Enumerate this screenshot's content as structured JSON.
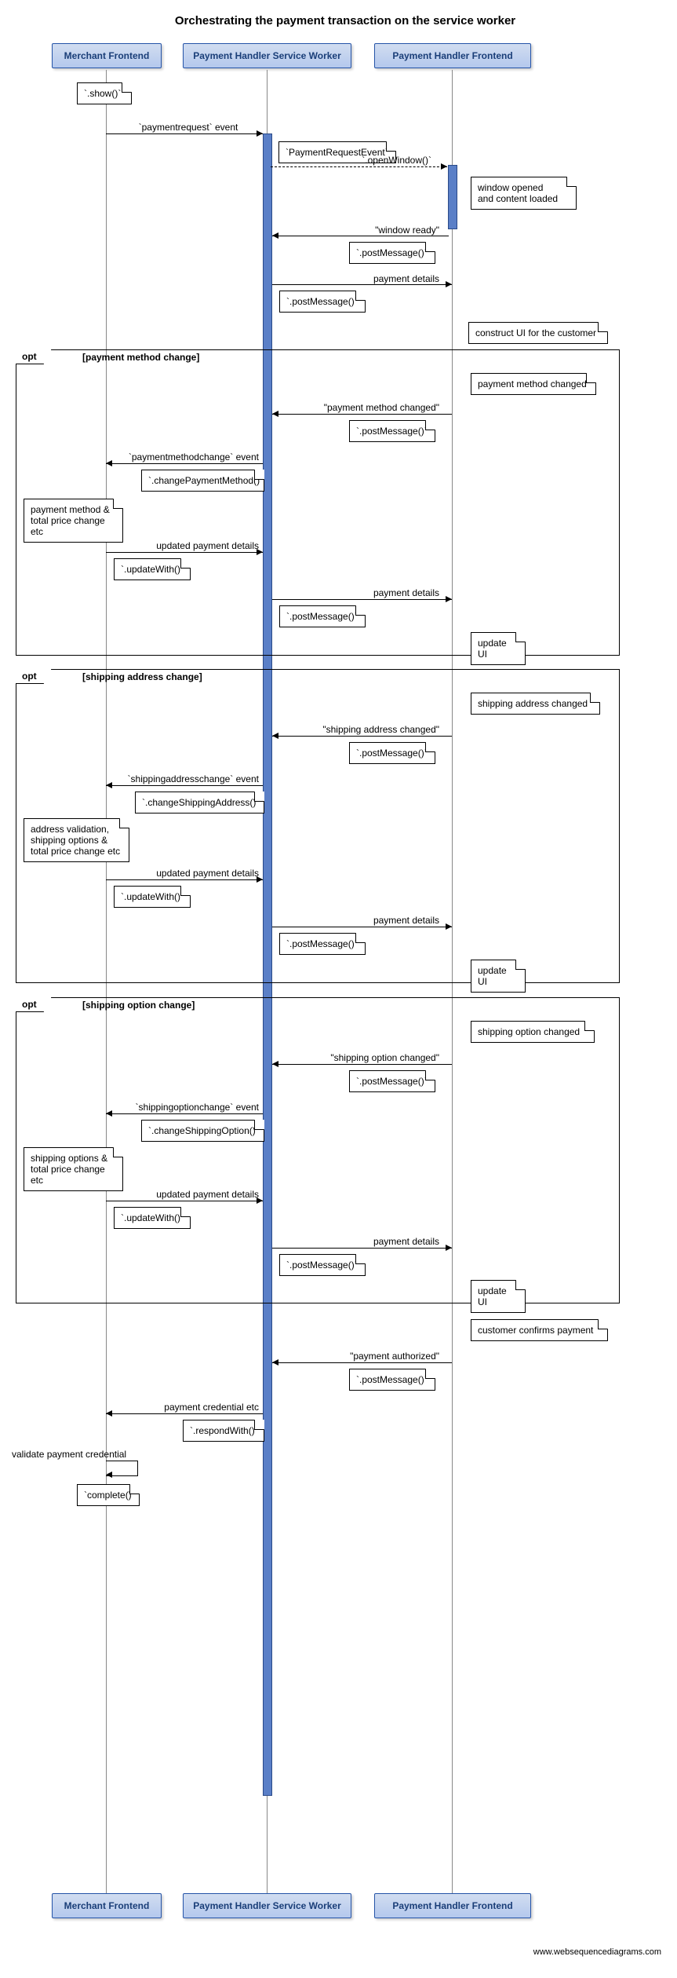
{
  "title": "Orchestrating the payment transaction on the service worker",
  "participants": {
    "merchant": "Merchant Frontend",
    "sw": "Payment Handler Service Worker",
    "ph": "Payment Handler Frontend"
  },
  "notes": {
    "show": "`.show()`",
    "preq_evt": "`PaymentRequestEvent`",
    "open_win": "window opened\nand content loaded",
    "pm1": "`.postMessage()`",
    "ui_build": "construct UI for the customer",
    "pm_change_note": "payment method changed",
    "cpm": "`.changePaymentMethod()`",
    "mf_pm_change": "payment method &\ntotal price change etc",
    "uw": "`.updateWith()`",
    "update_ui": "update UI",
    "sa_change": "shipping address changed",
    "csa": "`.changeShippingAddress()`",
    "mf_sa_change": "address validation,\nshipping options &\ntotal price change etc",
    "so_change": "shipping option changed",
    "cso": "`.changeShippingOption()`",
    "mf_so_change": "shipping options &\ntotal price change etc",
    "confirm": "customer confirms payment",
    "rw": "`.respondWith()`",
    "validate": "validate payment credential",
    "complete": "`complete()`"
  },
  "messages": {
    "paymentrequest_evt": "`paymentrequest` event",
    "open_window": "`.openWindow()`",
    "window_ready": "\"window ready\"",
    "payment_details": "payment details",
    "pm_changed": "\"payment method changed\"",
    "pmc_evt": "`paymentmethodchange` event",
    "updated_details": "updated payment details",
    "sa_changed": "\"shipping address changed\"",
    "sac_evt": "`shippingaddresschange` event",
    "so_changed": "\"shipping option changed\"",
    "soc_evt": "`shippingoptionchange` event",
    "pay_auth": "\"payment authorized\"",
    "pay_cred": "payment credential etc"
  },
  "opt": {
    "label": "opt",
    "g1": "[payment method change]",
    "g2": "[shipping address change]",
    "g3": "[shipping option change]"
  },
  "footer": "www.websequencediagrams.com"
}
